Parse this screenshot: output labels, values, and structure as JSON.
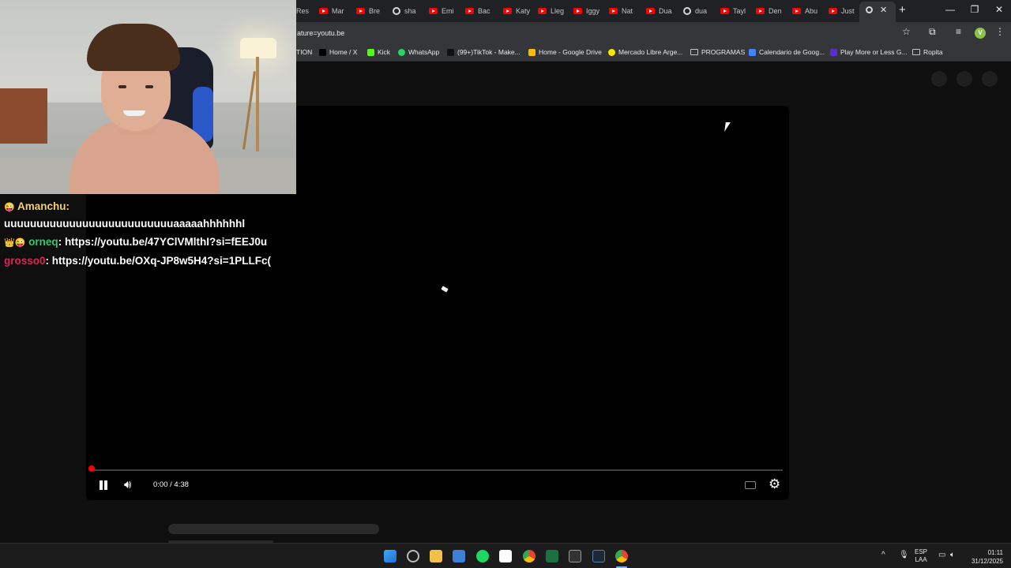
{
  "browser": {
    "tabs": [
      {
        "label": "Res",
        "icon": "youtube-icon"
      },
      {
        "label": "Mar",
        "icon": "youtube-icon"
      },
      {
        "label": "Bre",
        "icon": "youtube-icon"
      },
      {
        "label": "sha",
        "icon": "google-icon"
      },
      {
        "label": "Emi",
        "icon": "youtube-icon"
      },
      {
        "label": "Bac",
        "icon": "youtube-icon"
      },
      {
        "label": "Katy",
        "icon": "youtube-icon"
      },
      {
        "label": "Lleg",
        "icon": "youtube-icon"
      },
      {
        "label": "Iggy",
        "icon": "youtube-icon"
      },
      {
        "label": "Nat",
        "icon": "youtube-icon"
      },
      {
        "label": "Dua",
        "icon": "youtube-icon"
      },
      {
        "label": "dua",
        "icon": "google-icon"
      },
      {
        "label": "Tayl",
        "icon": "youtube-icon"
      },
      {
        "label": "Den",
        "icon": "youtube-icon"
      },
      {
        "label": "Abu",
        "icon": "youtube-icon"
      },
      {
        "label": "Just",
        "icon": "youtube-icon"
      }
    ],
    "active_tab_close": "✕",
    "new_tab": "+",
    "window_controls": {
      "minimize": "—",
      "maximize": "❐",
      "close": "✕"
    },
    "url": "ature=youtu.be",
    "profile_initial": "V",
    "bookmarks": [
      {
        "label": "TION",
        "icon": "none"
      },
      {
        "label": "Home / X",
        "icon": "x-icon"
      },
      {
        "label": "Kick",
        "icon": "kick-icon"
      },
      {
        "label": "WhatsApp",
        "icon": "whatsapp-icon"
      },
      {
        "label": "(99+)TikTok - Make...",
        "icon": "tiktok-icon"
      },
      {
        "label": "Home - Google Drive",
        "icon": "drive-icon"
      },
      {
        "label": "Mercado Libre Arge...",
        "icon": "mercadolibre-icon"
      },
      {
        "label": "PROGRAMAS",
        "icon": "folder-icon"
      },
      {
        "label": "Calendario de Goog...",
        "icon": "calendar-icon"
      },
      {
        "label": "Play More or Less G...",
        "icon": "game-icon"
      },
      {
        "label": "Ropita",
        "icon": "folder-icon"
      }
    ]
  },
  "player": {
    "current_time": "0:00",
    "separator": " / ",
    "duration": "4:38",
    "time_display": "0:00 / 4:38",
    "progress_fraction": 0.0
  },
  "chat": [
    {
      "badge": "😜",
      "user": "Amanchu",
      "message": "uuuuuuuuuuuuuuuuuuuuuuuuuuaaaaahhhhhhl"
    },
    {
      "badge": "👑😜",
      "user": "orneq",
      "message": "https://youtu.be/47YClVMlthI?si=fEEJ0u"
    },
    {
      "badge": "",
      "user": "grosso0",
      "message": "https://youtu.be/OXq-JP8w5H4?si=1PLLFc("
    }
  ],
  "taskbar": {
    "apps": [
      "windows-start-icon",
      "settings-icon",
      "file-explorer-icon",
      "store-icon",
      "spotify-icon",
      "capcut-icon",
      "chrome-icon",
      "excel-icon",
      "epic-games-icon",
      "steam-icon",
      "chrome-active-icon"
    ],
    "tray": {
      "language": "ESP",
      "layout": "LAA"
    },
    "time": "01:11",
    "date": "31/12/2025"
  },
  "colors": {
    "page_bg": "#0f0f0f",
    "chrome_dark": "#202124",
    "toolbar": "#35363a",
    "youtube_red": "#ff0000",
    "amanchu": "#f5d36a",
    "orneq": "#2ecc71",
    "grosso": "#e0245e"
  }
}
